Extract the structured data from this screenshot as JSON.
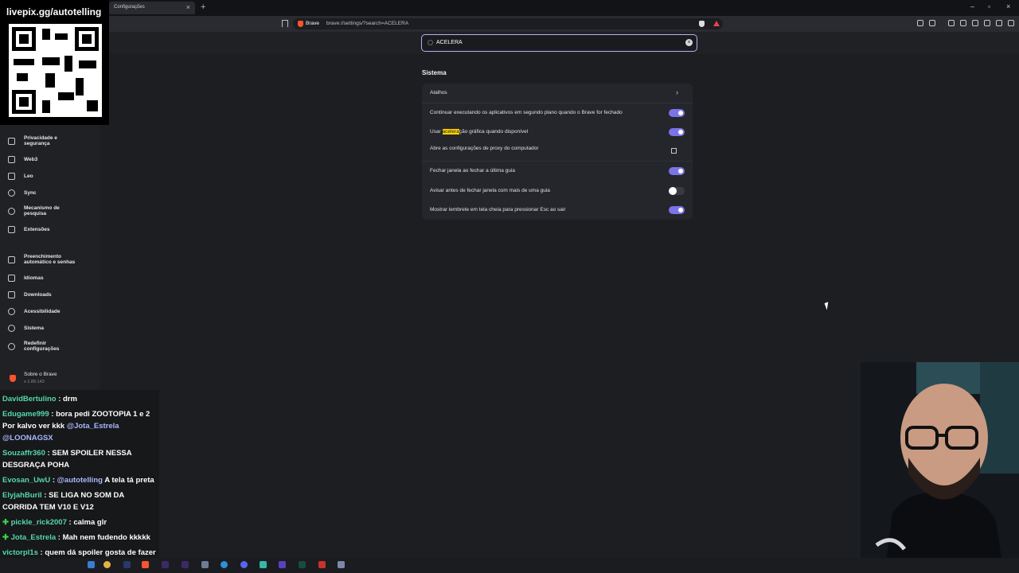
{
  "tab": {
    "title": "Configurações"
  },
  "address": {
    "site": "Brave",
    "url": "brave://settings/?search=ACELERA"
  },
  "search": {
    "query": "ACELERA"
  },
  "sidebar": {
    "items": [
      {
        "label": "Privacidade e segurança",
        "icon": "lock-icon"
      },
      {
        "label": "Web3",
        "icon": "wallet-icon"
      },
      {
        "label": "Leo",
        "icon": "leo-icon"
      },
      {
        "label": "Sync",
        "icon": "sync-icon"
      },
      {
        "label": "Mecanismo de pesquisa",
        "icon": "search-icon"
      },
      {
        "label": "Extensões",
        "icon": "puzzle-icon"
      },
      {
        "label": "Preenchimento automático e senhas",
        "icon": "list-icon"
      },
      {
        "label": "Idiomas",
        "icon": "language-icon"
      },
      {
        "label": "Downloads",
        "icon": "download-icon"
      },
      {
        "label": "Acessibilidade",
        "icon": "accessibility-icon"
      },
      {
        "label": "Sistema",
        "icon": "gear-icon"
      },
      {
        "label": "Redefinir configurações",
        "icon": "reset-icon"
      }
    ],
    "about": {
      "label": "Sobre o Brave",
      "version": "v 1.89.143"
    }
  },
  "section": {
    "title": "Sistema"
  },
  "settings": {
    "shortcuts": "Atalhos",
    "background": {
      "label": "Continuar executando os aplicativos em segundo plano quando o Brave for fechado",
      "enabled": true
    },
    "hw_accel": {
      "prefix": "Usar ",
      "highlight": "acelera",
      "suffix": "ção gráfica quando disponível",
      "enabled": true
    },
    "proxy": "Abre as configurações de proxy do computador",
    "close_window": {
      "label": "Fechar janela ao fechar a última guia",
      "enabled": true
    },
    "warn_close": {
      "label": "Avisar antes de fechar janela com mais de uma guia",
      "enabled": false
    },
    "fullscreen_reminder": {
      "label": "Mostrar lembrete em tela cheia para pressionar Esc ao sair",
      "enabled": true
    }
  },
  "overlay": {
    "qr_url": "livepix.gg/autotelling"
  },
  "chat": [
    {
      "user": "DavidBertulino",
      "text": " : drm"
    },
    {
      "user": "Edugame999",
      "text": " : bora pedi ZOOTOPIA 1 e 2 Por kalvo ver kkk ",
      "mention1": "@Jota_Estrela",
      "mention2": "@LOONAGSX"
    },
    {
      "user": "Souzaffr360",
      "text": " : SEM SPOILER NESSA DESGRAÇA POHA"
    },
    {
      "user": "Evosan_UwU",
      "text": " : ",
      "mention1": "@autotelling",
      "text2": " A tela tá preta"
    },
    {
      "user": "ElyjahBuril",
      "text": " : SE LIGA NO SOM DA CORRIDA TEM V10 E V12"
    },
    {
      "user": "pickle_rick2007",
      "text": " : calma glr"
    },
    {
      "user": "Jota_Estrela",
      "text": " : Mah nem fudendo kkkkk"
    },
    {
      "user": "victorpl1s",
      "text": " : quem dá spoiler gosta de fazer amor com o bumbum."
    }
  ],
  "colors": {
    "accent": "#7b73e8",
    "search_border": "#b7b0f2",
    "highlight": "#ffd400",
    "brave": "#fb542b"
  }
}
